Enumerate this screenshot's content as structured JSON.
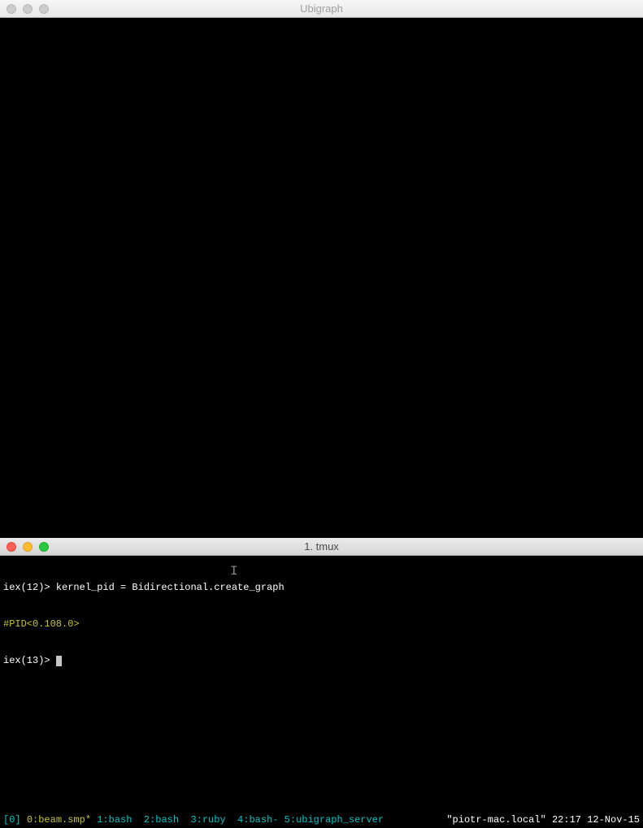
{
  "top_window": {
    "title": "Ubigraph"
  },
  "bottom_window": {
    "title": "1. tmux"
  },
  "terminal": {
    "line1_prompt": "iex(12)> ",
    "line1_command": "kernel_pid = Bidirectional.create_graph",
    "line2": "#PID<0.108.0>",
    "line3_prompt": "iex(13)> "
  },
  "tmux_status": {
    "session": "[0] ",
    "active_window": "0:beam.smp*",
    "windows": " 1:bash  2:bash  3:ruby  4:bash- 5:ubigraph_server",
    "hostname": "\"piotr-mac.local\"",
    "time": " 22:17 ",
    "date": "12-Nov-15"
  }
}
